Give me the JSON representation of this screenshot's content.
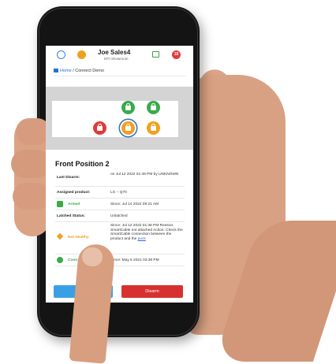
{
  "app": {
    "title": "Joe Sales4",
    "subtitle": "MTI Showroom",
    "notification_count": "18"
  },
  "breadcrumb": {
    "home": "Home",
    "separator": "/",
    "current": "Connect Demo"
  },
  "position": {
    "title": "Front Position 2"
  },
  "details": [
    {
      "label": "Last Disarm:",
      "value": "on Jul 12 2022 01:49 PM by UNKNOWN"
    },
    {
      "label": "Assigned product:",
      "value": "LG – Q70"
    },
    {
      "label": "Armed",
      "value": "Since: Jul 14 2022 09:21 AM"
    },
    {
      "label": "Latched Status:",
      "value": "Unlatched"
    },
    {
      "label": "Not Healthy",
      "value": "Since: Jul 12 2022 01:36 PM Reason: SmartCable not attached Action: Check the SmartCable connection between the product and the",
      "link": "puck"
    },
    {
      "label": "Conn",
      "value": "Since: May 5 2021 03:38 PM"
    }
  ],
  "buttons": {
    "primary": "",
    "disarm": "Disarm"
  },
  "colors": {
    "armed_green": "#3aaa4a",
    "warning_orange": "#f0a020",
    "alarm_red": "#e03a3a",
    "accent_blue": "#2a6fd1"
  }
}
